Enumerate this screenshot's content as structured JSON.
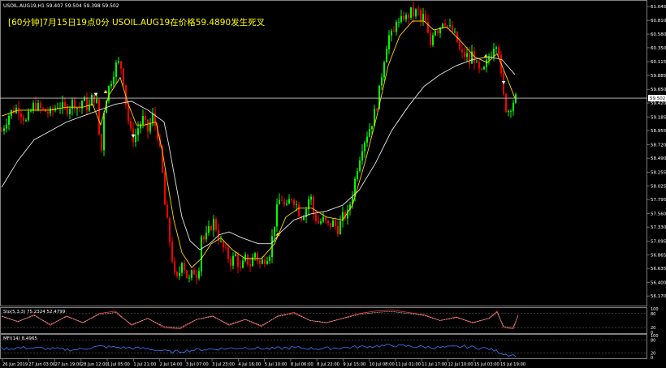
{
  "header": {
    "symbol_line": "USOIL.AUG19,H1  59.407 59.504 59.398 59.502",
    "alert_text": "[60分钟]7月15日19点0分 USOIL.AUG19在价格59.4890发生死叉"
  },
  "colors": {
    "background": "#000000",
    "bull": "#00ff00",
    "bear": "#ff0000",
    "fast_ma": "#ff3030",
    "mid_ma": "#ffd700",
    "slow_ma": "#e8e8e8",
    "stoch_main": "#ff3a3a",
    "stoch_signal": "#d8d8d8",
    "mfi": "#3a7dff",
    "axis_text": "#ffffff",
    "price_line": "#c8c8c8"
  },
  "price_axis": {
    "ticks": [
      "61.045",
      "60.810",
      "60.580",
      "60.350",
      "60.115",
      "59.885",
      "59.650",
      "59.420",
      "59.185",
      "58.955",
      "58.720",
      "58.490",
      "58.255",
      "58.025",
      "57.795",
      "57.560",
      "57.330",
      "57.095",
      "56.865",
      "56.635",
      "56.400",
      "56.170"
    ],
    "current": "59.502"
  },
  "time_axis": {
    "labels": [
      "26 Jun 2019",
      "27 Jun 03:00",
      "27 Jun 19:00",
      "28 Jun 12:00",
      "1 Jul 05:00",
      "1 Jul 21:00",
      "2 Jul 14:00",
      "3 Jul 07:00",
      "3 Jul 23:00",
      "4 Jul 16:00",
      "5 Jul 10:00",
      "8 Jul 06:00",
      "8 Jul 22:00",
      "9 Jul 15:00",
      "10 Jul 08:00",
      "11 Jul 01:00",
      "11 Jul 17:00",
      "12 Jul 10:00",
      "15 Jul 03:00",
      "15 Jul 19:00"
    ]
  },
  "stoch": {
    "label": "Sto(5,3,3) 75.2324 52.4799",
    "scale": [
      "100",
      "80",
      "20",
      "0"
    ]
  },
  "mfi": {
    "label": "MFI(14) 8.4965",
    "scale": [
      "100",
      "80",
      "20",
      "0"
    ]
  },
  "chart_data": {
    "type": "candlestick",
    "symbol": "USOIL.AUG19",
    "timeframe": "H1",
    "ylim": [
      56.05,
      61.1
    ],
    "close_path": [
      [
        0,
        58.95
      ],
      [
        10,
        59.25
      ],
      [
        20,
        59.35
      ],
      [
        30,
        59.1
      ],
      [
        40,
        59.4
      ],
      [
        50,
        59.3
      ],
      [
        60,
        59.25
      ],
      [
        70,
        59.4
      ],
      [
        80,
        59.3
      ],
      [
        88,
        59.45
      ],
      [
        95,
        59.3
      ],
      [
        100,
        59.5
      ],
      [
        107,
        59.3
      ],
      [
        112,
        59.55
      ],
      [
        118,
        59.4
      ],
      [
        122,
        58.4
      ],
      [
        126,
        59.3
      ],
      [
        130,
        59.6
      ],
      [
        136,
        59.85
      ],
      [
        140,
        60.05
      ],
      [
        146,
        60.1
      ],
      [
        150,
        59.8
      ],
      [
        154,
        59.3
      ],
      [
        158,
        58.95
      ],
      [
        163,
        58.8
      ],
      [
        168,
        59.0
      ],
      [
        174,
        59.15
      ],
      [
        180,
        58.95
      ],
      [
        186,
        59.2
      ],
      [
        192,
        58.9
      ],
      [
        197,
        58.4
      ],
      [
        201,
        57.7
      ],
      [
        205,
        57.3
      ],
      [
        210,
        56.8
      ],
      [
        214,
        56.4
      ],
      [
        218,
        56.5
      ],
      [
        222,
        56.8
      ],
      [
        226,
        56.6
      ],
      [
        230,
        56.4
      ],
      [
        236,
        56.6
      ],
      [
        242,
        56.5
      ],
      [
        246,
        57.2
      ],
      [
        250,
        57.1
      ],
      [
        256,
        57.3
      ],
      [
        262,
        57.45
      ],
      [
        266,
        57.2
      ],
      [
        270,
        57.05
      ],
      [
        276,
        56.9
      ],
      [
        282,
        56.75
      ],
      [
        288,
        56.85
      ],
      [
        294,
        56.6
      ],
      [
        300,
        56.8
      ],
      [
        306,
        56.7
      ],
      [
        312,
        56.9
      ],
      [
        318,
        56.7
      ],
      [
        324,
        56.8
      ],
      [
        330,
        56.9
      ],
      [
        336,
        57.4
      ],
      [
        340,
        57.7
      ],
      [
        344,
        57.85
      ],
      [
        350,
        57.6
      ],
      [
        356,
        57.85
      ],
      [
        362,
        57.75
      ],
      [
        368,
        57.5
      ],
      [
        374,
        57.6
      ],
      [
        380,
        57.9
      ],
      [
        384,
        57.55
      ],
      [
        390,
        57.4
      ],
      [
        396,
        57.45
      ],
      [
        402,
        57.35
      ],
      [
        408,
        57.4
      ],
      [
        414,
        57.3
      ],
      [
        420,
        57.5
      ],
      [
        426,
        57.55
      ],
      [
        432,
        57.9
      ],
      [
        438,
        58.35
      ],
      [
        444,
        58.7
      ],
      [
        450,
        58.9
      ],
      [
        456,
        59.1
      ],
      [
        462,
        59.4
      ],
      [
        466,
        59.7
      ],
      [
        470,
        60.1
      ],
      [
        474,
        60.4
      ],
      [
        478,
        60.6
      ],
      [
        482,
        60.5
      ],
      [
        486,
        60.85
      ],
      [
        490,
        60.7
      ],
      [
        494,
        60.9
      ],
      [
        498,
        60.85
      ],
      [
        504,
        60.95
      ],
      [
        508,
        60.9
      ],
      [
        512,
        61.0
      ],
      [
        516,
        60.8
      ],
      [
        520,
        60.9
      ],
      [
        524,
        60.6
      ],
      [
        528,
        60.4
      ],
      [
        532,
        60.7
      ],
      [
        538,
        60.65
      ],
      [
        544,
        60.85
      ],
      [
        550,
        60.7
      ],
      [
        556,
        60.6
      ],
      [
        560,
        60.5
      ],
      [
        564,
        60.3
      ],
      [
        568,
        60.2
      ],
      [
        572,
        60.25
      ],
      [
        576,
        60.1
      ],
      [
        580,
        60.3
      ],
      [
        584,
        60.05
      ],
      [
        588,
        59.95
      ],
      [
        592,
        59.9
      ],
      [
        596,
        60.05
      ],
      [
        600,
        60.2
      ],
      [
        604,
        60.3
      ],
      [
        608,
        60.5
      ],
      [
        612,
        60.3
      ],
      [
        616,
        59.7
      ],
      [
        620,
        59.35
      ],
      [
        624,
        59.3
      ],
      [
        628,
        59.4
      ],
      [
        632,
        59.5
      ]
    ],
    "slow_ma_path": [
      [
        0,
        58.0
      ],
      [
        20,
        58.45
      ],
      [
        40,
        58.8
      ],
      [
        60,
        58.95
      ],
      [
        80,
        59.1
      ],
      [
        100,
        59.2
      ],
      [
        120,
        59.3
      ],
      [
        140,
        59.4
      ],
      [
        160,
        59.45
      ],
      [
        180,
        59.3
      ],
      [
        200,
        59.1
      ],
      [
        206,
        58.7
      ],
      [
        214,
        58.1
      ],
      [
        222,
        57.5
      ],
      [
        232,
        57.1
      ],
      [
        244,
        56.95
      ],
      [
        256,
        57.05
      ],
      [
        268,
        57.2
      ],
      [
        280,
        57.25
      ],
      [
        296,
        57.15
      ],
      [
        316,
        57.05
      ],
      [
        332,
        57.05
      ],
      [
        344,
        57.25
      ],
      [
        360,
        57.45
      ],
      [
        380,
        57.55
      ],
      [
        400,
        57.6
      ],
      [
        420,
        57.7
      ],
      [
        440,
        57.95
      ],
      [
        460,
        58.4
      ],
      [
        480,
        58.95
      ],
      [
        500,
        59.35
      ],
      [
        520,
        59.7
      ],
      [
        540,
        59.9
      ],
      [
        560,
        60.05
      ],
      [
        580,
        60.15
      ],
      [
        600,
        60.2
      ],
      [
        616,
        60.15
      ],
      [
        632,
        59.9
      ]
    ],
    "mid_ma_path": [
      [
        0,
        59.2
      ],
      [
        20,
        59.3
      ],
      [
        40,
        59.3
      ],
      [
        60,
        59.3
      ],
      [
        80,
        59.35
      ],
      [
        100,
        59.35
      ],
      [
        112,
        59.4
      ],
      [
        122,
        59.05
      ],
      [
        132,
        59.55
      ],
      [
        146,
        59.85
      ],
      [
        156,
        59.4
      ],
      [
        166,
        59.05
      ],
      [
        176,
        59.05
      ],
      [
        190,
        59.1
      ],
      [
        198,
        58.6
      ],
      [
        204,
        58.1
      ],
      [
        212,
        57.45
      ],
      [
        222,
        56.9
      ],
      [
        234,
        56.65
      ],
      [
        246,
        56.8
      ],
      [
        258,
        57.05
      ],
      [
        270,
        57.15
      ],
      [
        284,
        56.95
      ],
      [
        300,
        56.8
      ],
      [
        320,
        56.8
      ],
      [
        336,
        57.05
      ],
      [
        350,
        57.5
      ],
      [
        366,
        57.65
      ],
      [
        382,
        57.65
      ],
      [
        400,
        57.5
      ],
      [
        420,
        57.45
      ],
      [
        432,
        57.7
      ],
      [
        448,
        58.45
      ],
      [
        462,
        59.2
      ],
      [
        476,
        60.05
      ],
      [
        490,
        60.55
      ],
      [
        506,
        60.8
      ],
      [
        520,
        60.8
      ],
      [
        532,
        60.65
      ],
      [
        548,
        60.7
      ],
      [
        566,
        60.45
      ],
      [
        582,
        60.2
      ],
      [
        598,
        60.1
      ],
      [
        610,
        60.25
      ],
      [
        622,
        59.85
      ],
      [
        632,
        59.5
      ]
    ],
    "signal_points": [
      {
        "x_index": 116,
        "price": 59.55,
        "direction": "down"
      },
      {
        "x_index": 128,
        "price": 59.6,
        "direction": "up"
      },
      {
        "x_index": 162,
        "price": 58.85,
        "direction": "down"
      },
      {
        "x_index": 340,
        "price": 57.2,
        "direction": "up"
      },
      {
        "x_index": 596,
        "price": 60.2,
        "direction": "up"
      },
      {
        "x_index": 618,
        "price": 59.75,
        "direction": "down"
      }
    ],
    "current_price": 59.502,
    "stoch_path": [
      [
        0,
        70
      ],
      [
        20,
        45
      ],
      [
        40,
        75
      ],
      [
        60,
        30
      ],
      [
        80,
        70
      ],
      [
        100,
        40
      ],
      [
        120,
        80
      ],
      [
        140,
        90
      ],
      [
        160,
        30
      ],
      [
        180,
        60
      ],
      [
        200,
        20
      ],
      [
        220,
        15
      ],
      [
        240,
        55
      ],
      [
        260,
        70
      ],
      [
        280,
        30
      ],
      [
        300,
        55
      ],
      [
        320,
        25
      ],
      [
        340,
        70
      ],
      [
        360,
        85
      ],
      [
        380,
        50
      ],
      [
        400,
        40
      ],
      [
        420,
        60
      ],
      [
        440,
        80
      ],
      [
        460,
        90
      ],
      [
        480,
        95
      ],
      [
        500,
        85
      ],
      [
        520,
        75
      ],
      [
        540,
        50
      ],
      [
        560,
        65
      ],
      [
        580,
        40
      ],
      [
        600,
        60
      ],
      [
        610,
        90
      ],
      [
        618,
        20
      ],
      [
        630,
        15
      ],
      [
        636,
        75
      ]
    ],
    "mfi_path": [
      [
        0,
        40
      ],
      [
        30,
        45
      ],
      [
        60,
        40
      ],
      [
        90,
        35
      ],
      [
        120,
        50
      ],
      [
        150,
        45
      ],
      [
        180,
        40
      ],
      [
        210,
        25
      ],
      [
        240,
        35
      ],
      [
        270,
        40
      ],
      [
        300,
        45
      ],
      [
        330,
        40
      ],
      [
        360,
        45
      ],
      [
        390,
        40
      ],
      [
        420,
        45
      ],
      [
        450,
        50
      ],
      [
        480,
        55
      ],
      [
        510,
        50
      ],
      [
        540,
        45
      ],
      [
        570,
        50
      ],
      [
        600,
        40
      ],
      [
        620,
        15
      ],
      [
        636,
        8
      ]
    ]
  }
}
